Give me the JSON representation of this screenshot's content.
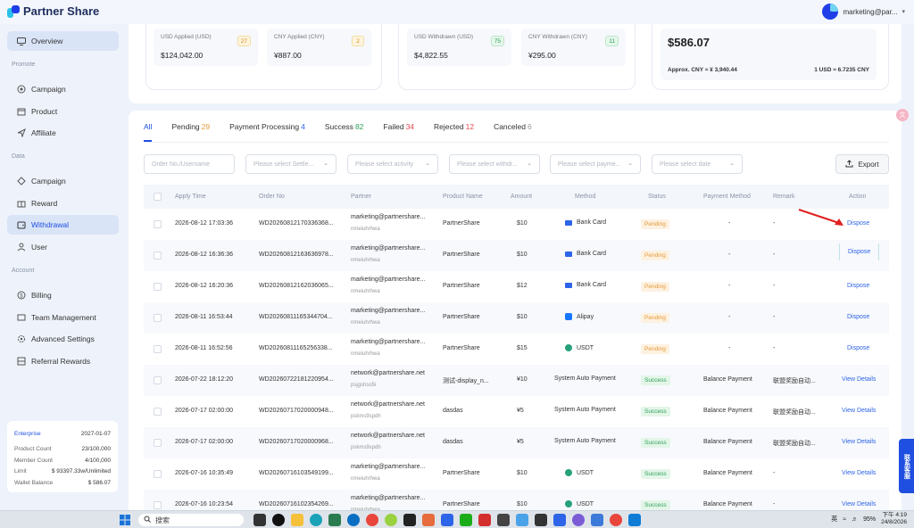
{
  "brand": {
    "name": "Partner Share"
  },
  "user": {
    "email": "marketing@par..."
  },
  "sidebar": {
    "overview": "Overview",
    "promote_label": "Promote",
    "promote": [
      "Campaign",
      "Product",
      "Affiliate"
    ],
    "data_label": "Data",
    "data": [
      "Campaign",
      "Reward",
      "Withdrawal",
      "User"
    ],
    "account_label": "Account",
    "account": [
      "Billing",
      "Team Management",
      "Advanced Settings",
      "Referral Rewards"
    ],
    "enterprise": {
      "plan": "Enterprise",
      "expiry": "2027-01-07",
      "rows": [
        {
          "k": "Product Count",
          "v": "23/100,000"
        },
        {
          "k": "Member Count",
          "v": "4/100,000"
        },
        {
          "k": "Limit",
          "v": "$ 93397.33w/Unlimited"
        },
        {
          "k": "Wallet Balance",
          "v": "$ 586.07"
        }
      ]
    }
  },
  "stats": {
    "usd_applied": {
      "label": "USD Applied (USD)",
      "value": "$124,042.00",
      "badge": "27"
    },
    "cny_applied": {
      "label": "CNY Applied (CNY)",
      "value": "¥887.00",
      "badge": "2"
    },
    "usd_withdrawn": {
      "label": "USD Withdrawn (USD)",
      "value": "$4,822.55",
      "badge": "75"
    },
    "cny_withdrawn": {
      "label": "CNY Withdrawn (CNY)",
      "value": "¥295.00",
      "badge": "11"
    },
    "balance": {
      "value": "$586.07",
      "approx": "Approx. CNY ≈ ¥ 3,940.44",
      "rate": "1 USD ≈ 6.7235 CNY"
    }
  },
  "tabs": [
    {
      "label": "All",
      "count": ""
    },
    {
      "label": "Pending",
      "count": "29"
    },
    {
      "label": "Payment Processing",
      "count": "4"
    },
    {
      "label": "Success",
      "count": "82"
    },
    {
      "label": "Failed",
      "count": "34"
    },
    {
      "label": "Rejected",
      "count": "12"
    },
    {
      "label": "Canceled",
      "count": "6"
    }
  ],
  "filters": {
    "order": "Order No./Username",
    "settlement": "Please select Settle...",
    "activity": "Please select activity",
    "withdraw": "Please select withdr...",
    "payment": "Please select payme...",
    "date": "Please select date",
    "export": "Export"
  },
  "columns": [
    "Apply Time",
    "Order No",
    "Partner",
    "Product Name",
    "Amount",
    "Method",
    "Status",
    "Payment Method",
    "Remark",
    "Action"
  ],
  "rows": [
    {
      "time": "2026-08-12 17:03:36",
      "order": "WD20260812170336368...",
      "partner": "marketing@partnershare...",
      "sub": "nmeiuhrhwa",
      "product": "PartnerShare",
      "amount": "$10",
      "method": "Bank Card",
      "method_icon": "bank-card-icon",
      "status": "Pending",
      "pay": "-",
      "remark": "-",
      "action": "Dispose"
    },
    {
      "time": "2026-08-12 16:36:36",
      "order": "WD20260812163636978...",
      "partner": "marketing@partnershare...",
      "sub": "nmeiuhrhwa",
      "product": "PartnerShare",
      "amount": "$10",
      "method": "Bank Card",
      "method_icon": "bank-card-icon",
      "status": "Pending",
      "pay": "-",
      "remark": "-",
      "action": "Dispose"
    },
    {
      "time": "2026-08-12 16:20:36",
      "order": "WD20260812162036065...",
      "partner": "marketing@partnershare...",
      "sub": "nmeiuhrhwa",
      "product": "PartnerShare",
      "amount": "$12",
      "method": "Bank Card",
      "method_icon": "bank-card-icon",
      "status": "Pending",
      "pay": "-",
      "remark": "-",
      "action": "Dispose"
    },
    {
      "time": "2026-08-11 16:53:44",
      "order": "WD20260811165344704...",
      "partner": "marketing@partnershare...",
      "sub": "nmeiuhrhwa",
      "product": "PartnerShare",
      "amount": "$10",
      "method": "Alipay",
      "method_icon": "alipay-icon",
      "status": "Pending",
      "pay": "-",
      "remark": "-",
      "action": "Dispose"
    },
    {
      "time": "2026-08-11 16:52:56",
      "order": "WD20260811165256338...",
      "partner": "marketing@partnershare...",
      "sub": "nmeiuhrhwa",
      "product": "PartnerShare",
      "amount": "$15",
      "method": "USDT",
      "method_icon": "usdt-icon",
      "status": "Pending",
      "pay": "-",
      "remark": "-",
      "action": "Dispose"
    },
    {
      "time": "2026-07-22 18:12:20",
      "order": "WD20260722181220954...",
      "partner": "network@partnershare.net",
      "sub": "psjgshso5i",
      "product": "测试-display_n...",
      "amount": "¥10",
      "method": "System Auto Payment",
      "method_icon": "",
      "status": "Success",
      "pay": "Balance Payment",
      "remark": "联盟奖励自动...",
      "action": "View Details"
    },
    {
      "time": "2026-07-17 02:00:00",
      "order": "WD20260717020000948...",
      "partner": "network@partnershare.net",
      "sub": "pskms9spdh",
      "product": "dasdas",
      "amount": "¥5",
      "method": "System Auto Payment",
      "method_icon": "",
      "status": "Success",
      "pay": "Balance Payment",
      "remark": "联盟奖励自动...",
      "action": "View Details"
    },
    {
      "time": "2026-07-17 02:00:00",
      "order": "WD20260717020000968...",
      "partner": "network@partnershare.net",
      "sub": "pskms9spdh",
      "product": "dasdas",
      "amount": "¥5",
      "method": "System Auto Payment",
      "method_icon": "",
      "status": "Success",
      "pay": "Balance Payment",
      "remark": "联盟奖励自动...",
      "action": "View Details"
    },
    {
      "time": "2026-07-16 10:35:49",
      "order": "WD20260716103549199...",
      "partner": "marketing@partnershare...",
      "sub": "nmeiuhrhwa",
      "product": "PartnerShare",
      "amount": "$10",
      "method": "USDT",
      "method_icon": "usdt-icon",
      "status": "Success",
      "pay": "Balance Payment",
      "remark": "-",
      "action": "View Details"
    },
    {
      "time": "2026-07-16 10:23:54",
      "order": "WD20260716102354269...",
      "partner": "marketing@partnershare...",
      "sub": "nmeiuhrhwa",
      "product": "PartnerShare",
      "amount": "$10",
      "method": "USDT",
      "method_icon": "usdt-icon",
      "status": "Success",
      "pay": "Balance Payment",
      "remark": "-",
      "action": "View Details"
    }
  ],
  "side_widget": "联系客服",
  "taskbar": {
    "search": "搜索",
    "lang": "英",
    "battery": "95%",
    "time": "下午 4:19",
    "date": "24/8/2026"
  },
  "colors": {
    "accent": "#1f4fe0",
    "pending": "#e79b39",
    "success": "#2ea05a"
  }
}
